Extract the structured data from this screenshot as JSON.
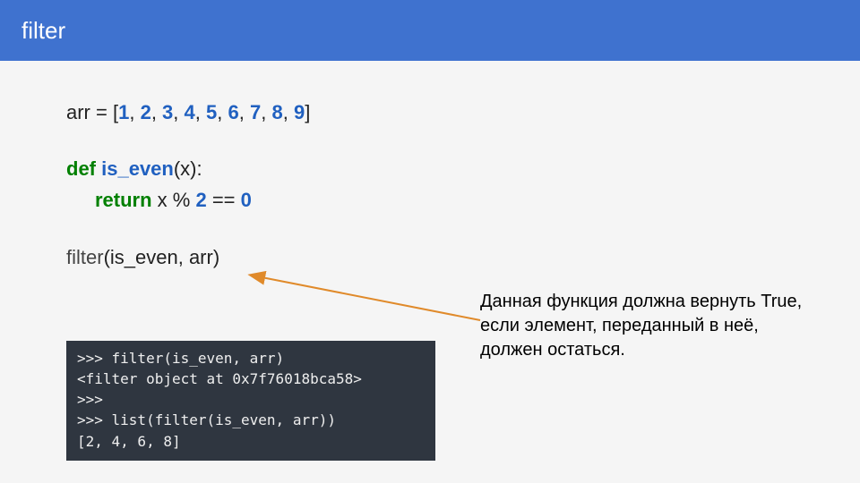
{
  "header": {
    "title": "filter"
  },
  "code": {
    "line1_pre": "arr = [",
    "nums": [
      "1",
      "2",
      "3",
      "4",
      "5",
      "6",
      "7",
      "8",
      "9"
    ],
    "line1_post": "]",
    "def_kw": "def",
    "fn_name": "is_even",
    "def_sig_tail": "(x):",
    "ret_kw": "return",
    "ret_mid": " x % ",
    "ret_two": "2",
    "ret_eq": " == ",
    "ret_zero": "0",
    "call_pre": "filter",
    "call_args": "(is_even, arr)"
  },
  "terminal": {
    "l1": ">>> filter(is_even, arr)",
    "l2": "<filter object at 0x7f76018bca58>",
    "l3": ">>>",
    "l4": ">>> list(filter(is_even, arr))",
    "l5": "[2, 4, 6, 8]"
  },
  "annotation": {
    "text": "Данная функция должна вернуть True, если элемент, переданный в неё, должен остаться."
  }
}
